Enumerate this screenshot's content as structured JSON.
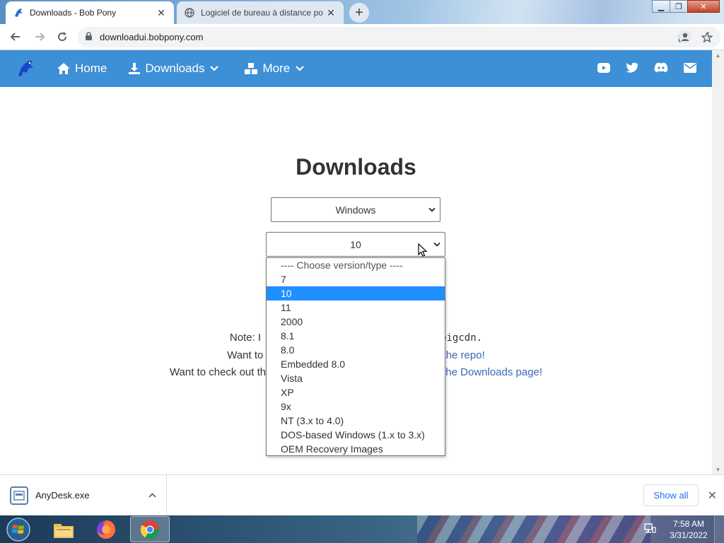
{
  "browser": {
    "tabs": [
      {
        "label": "Downloads - Bob Pony",
        "active": true,
        "icon": "bob-pony-icon"
      },
      {
        "label": "Logiciel de bureau à distance po",
        "active": false,
        "icon": "globe-icon"
      }
    ],
    "new_tab_glyph": "+",
    "url": "downloadui.bobpony.com"
  },
  "site_nav": {
    "brand_icon": "bob-pony-logo",
    "items": [
      {
        "label": "Home",
        "icon": "home-icon",
        "has_menu": false
      },
      {
        "label": "Downloads",
        "icon": "download-icon",
        "has_menu": true
      },
      {
        "label": "More",
        "icon": "cubes-icon",
        "has_menu": true
      }
    ],
    "social_icons": [
      "youtube-icon",
      "twitter-icon",
      "discord-icon",
      "email-icon"
    ],
    "background": "#3d8fd6"
  },
  "main": {
    "title": "Downloads",
    "os_select": {
      "value": "Windows"
    },
    "version_select": {
      "value": "10"
    },
    "note_lines": [
      {
        "before": "Note: I",
        "after": "bigcdn."
      },
      {
        "before": "Want to ",
        "link": "the repo!"
      },
      {
        "before": "Want to check out th",
        "link": "the Downloads page!"
      }
    ],
    "version_options": [
      {
        "label": "---- Choose version/type ----",
        "selected": false
      },
      {
        "label": "7",
        "selected": false
      },
      {
        "label": "10",
        "selected": true
      },
      {
        "label": "11",
        "selected": false
      },
      {
        "label": "2000",
        "selected": false
      },
      {
        "label": "8.1",
        "selected": false
      },
      {
        "label": "8.0",
        "selected": false
      },
      {
        "label": "Embedded 8.0",
        "selected": false
      },
      {
        "label": "Vista",
        "selected": false
      },
      {
        "label": "XP",
        "selected": false
      },
      {
        "label": "9x",
        "selected": false
      },
      {
        "label": "NT (3.x to 4.0)",
        "selected": false
      },
      {
        "label": "DOS-based Windows (1.x to 3.x)",
        "selected": false
      },
      {
        "label": "OEM Recovery Images",
        "selected": false
      }
    ],
    "selection_color": "#1e90ff"
  },
  "download_bar": {
    "file_name": "AnyDesk.exe",
    "show_all_label": "Show all"
  },
  "taskbar": {
    "apps": [
      "explorer-icon",
      "firefox-icon",
      "chrome-icon"
    ],
    "active_app": "chrome-icon",
    "time": "7:58 AM",
    "date": "3/31/2022"
  }
}
